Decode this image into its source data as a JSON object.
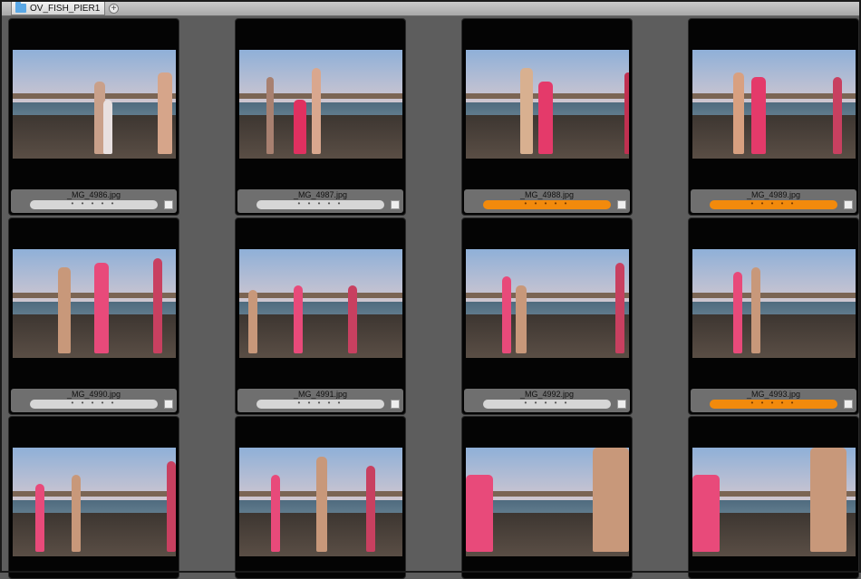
{
  "tab": {
    "label": "OV_FISH_PIER1",
    "add_label": "+"
  },
  "rating_dots": "• • • • •",
  "thumbnails": [
    {
      "name": "_MG_4986.jpg",
      "label": "orange",
      "color": "#d6d6d6"
    },
    {
      "name": "_MG_4987.jpg",
      "label": "none"
    },
    {
      "name": "_MG_4988.jpg",
      "label": "orange"
    },
    {
      "name": "_MG_4989.jpg",
      "label": "orange"
    },
    {
      "name": "_MG_4990.jpg",
      "label": "none"
    },
    {
      "name": "_MG_4991.jpg",
      "label": "none"
    },
    {
      "name": "_MG_4992.jpg",
      "label": "none"
    },
    {
      "name": "_MG_4993.jpg",
      "label": "orange"
    },
    {
      "name": "",
      "label": "none"
    },
    {
      "name": "",
      "label": "none"
    },
    {
      "name": "",
      "label": "none"
    },
    {
      "name": "",
      "label": "none"
    }
  ],
  "colors": {
    "label_orange": "#f28a0c",
    "label_none": "#d6d6d6",
    "background": "#5d5d5d"
  }
}
